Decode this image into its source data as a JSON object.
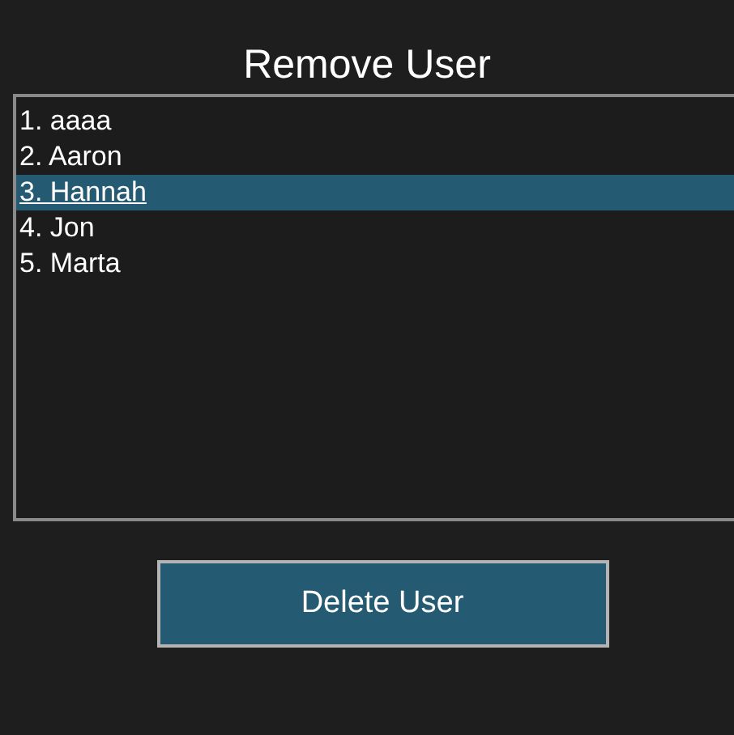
{
  "window": {
    "title": "Remove User"
  },
  "users": [
    {
      "label": "1. aaaa",
      "selected": false
    },
    {
      "label": "2. Aaron",
      "selected": false
    },
    {
      "label": "3. Hannah",
      "selected": true
    },
    {
      "label": "4. Jon",
      "selected": false
    },
    {
      "label": "5. Marta",
      "selected": false
    }
  ],
  "buttons": [
    {
      "label": "Delete User"
    }
  ]
}
